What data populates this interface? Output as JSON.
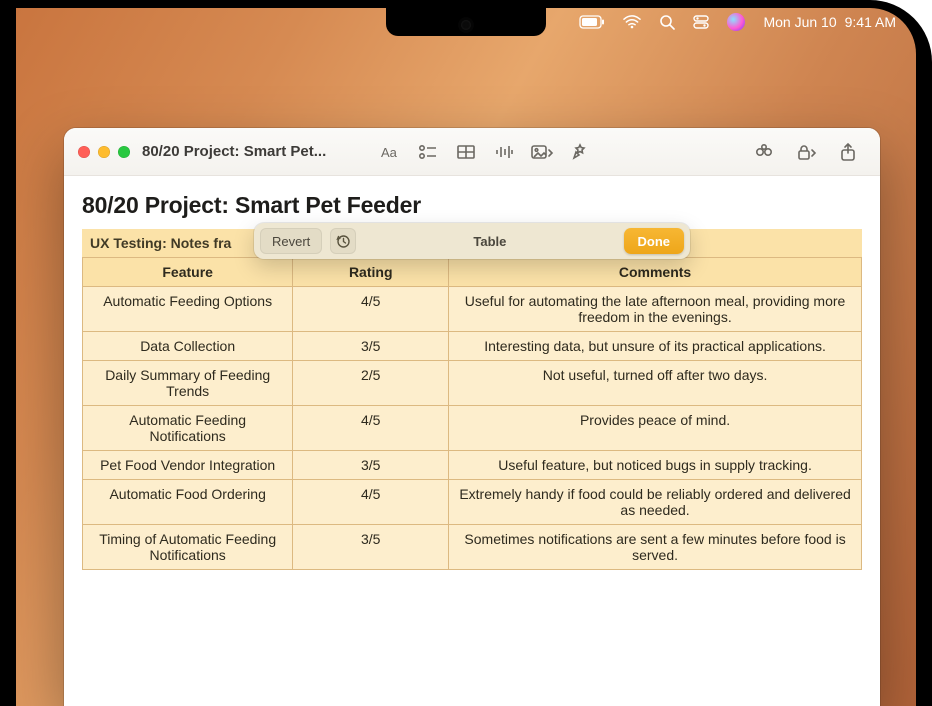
{
  "menubar": {
    "date": "Mon Jun 10",
    "time": "9:41 AM"
  },
  "window": {
    "title": "80/20 Project: Smart Pet..."
  },
  "note": {
    "title": "80/20 Project: Smart Pet Feeder",
    "subheader": "UX Testing: Notes fra"
  },
  "pill": {
    "revert": "Revert",
    "label": "Table",
    "done": "Done"
  },
  "table": {
    "headers": [
      "Feature",
      "Rating",
      "Comments"
    ],
    "rows": [
      {
        "feature": "Automatic Feeding Options",
        "rating": "4/5",
        "comments": "Useful for automating the late afternoon meal, providing more freedom in the evenings."
      },
      {
        "feature": "Data Collection",
        "rating": "3/5",
        "comments": "Interesting data, but unsure of its practical applications."
      },
      {
        "feature": "Daily Summary of Feeding Trends",
        "rating": "2/5",
        "comments": "Not useful, turned off after two days."
      },
      {
        "feature": "Automatic Feeding Notifications",
        "rating": "4/5",
        "comments": "Provides peace of mind."
      },
      {
        "feature": "Pet Food Vendor Integration",
        "rating": "3/5",
        "comments": "Useful feature, but noticed bugs in supply tracking."
      },
      {
        "feature": "Automatic Food Ordering",
        "rating": "4/5",
        "comments": "Extremely handy if food could be reliably ordered and delivered as needed."
      },
      {
        "feature": "Timing of Automatic Feeding Notifications",
        "rating": "3/5",
        "comments": "Sometimes notifications are sent a few minutes before food is served."
      }
    ]
  }
}
